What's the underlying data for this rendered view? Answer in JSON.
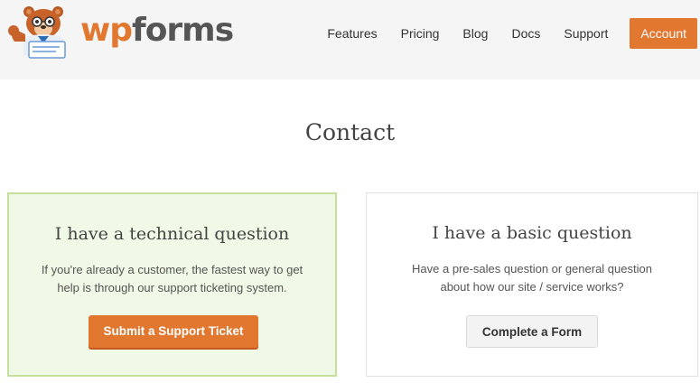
{
  "header": {
    "logo": {
      "wp": "wp",
      "forms": "forms",
      "icon": "bear-mascot-icon"
    },
    "nav": [
      {
        "label": "Features"
      },
      {
        "label": "Pricing"
      },
      {
        "label": "Blog"
      },
      {
        "label": "Docs"
      },
      {
        "label": "Support"
      }
    ],
    "account_label": "Account"
  },
  "main": {
    "title": "Contact",
    "cards": [
      {
        "heading": "I have a technical question",
        "line1": "If you're already a customer, the fastest way to get",
        "line2": "help is through our support ticketing system.",
        "button": "Submit a Support Ticket"
      },
      {
        "heading": "I have a basic question",
        "line1": "Have a pre-sales question or general question",
        "line2": "about how our site / service works?",
        "button": "Complete a Form"
      }
    ]
  },
  "colors": {
    "brand_orange": "#e27730",
    "header_bg": "#f5f5f5",
    "highlight_card_bg": "#f0f8e6",
    "highlight_card_border": "#c4e09b"
  }
}
